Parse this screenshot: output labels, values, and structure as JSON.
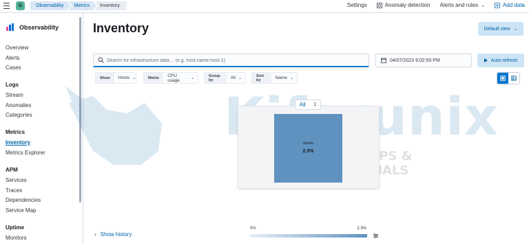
{
  "app": {
    "space_letter": "G",
    "breadcrumbs": [
      "Observability",
      "Metrics",
      "Inventory"
    ]
  },
  "header": {
    "settings": "Settings",
    "anomaly_detection": "Anomaly detection",
    "alerts_and_rules": "Alerts and rules",
    "add_data": "Add data"
  },
  "sidebar": {
    "title": "Observability",
    "overview": "Overview",
    "alerts": "Alerts",
    "cases": "Cases",
    "logs_heading": "Logs",
    "stream": "Stream",
    "anomalies": "Anomalies",
    "categories": "Categories",
    "metrics_heading": "Metrics",
    "inventory": "Inventory",
    "metrics_explorer": "Metrics Explorer",
    "apm_heading": "APM",
    "services": "Services",
    "traces": "Traces",
    "dependencies": "Dependencies",
    "service_map": "Service Map",
    "uptime_heading": "Uptime",
    "monitors": "Monitors"
  },
  "main": {
    "title": "Inventory",
    "default_view": "Default view",
    "search_placeholder": "Search for infrastructure data… (e.g. host.name:host-1)",
    "date": "04/07/2023 9:02:50 PM",
    "auto_refresh": "Auto-refresh",
    "filters": [
      {
        "label": "Show",
        "value": "Hosts"
      },
      {
        "label": "Metric",
        "value": "CPU usage"
      },
      {
        "label": "Group by",
        "value": "All"
      },
      {
        "label": "Sort by",
        "value": "Name"
      }
    ],
    "group": {
      "name": "All",
      "count": "1"
    },
    "node": {
      "label": "ubuntu",
      "value": "2.3%"
    },
    "show_history": "Show history",
    "legend": {
      "min": "0%",
      "max": "2.3%"
    }
  },
  "watermark": {
    "text": "Kifarunix",
    "subtext": "*NIX TIPS & TUTORIALS"
  },
  "colors": {
    "accent": "#0077cc",
    "node": "#6092c0",
    "space_badge": "#54b399"
  }
}
